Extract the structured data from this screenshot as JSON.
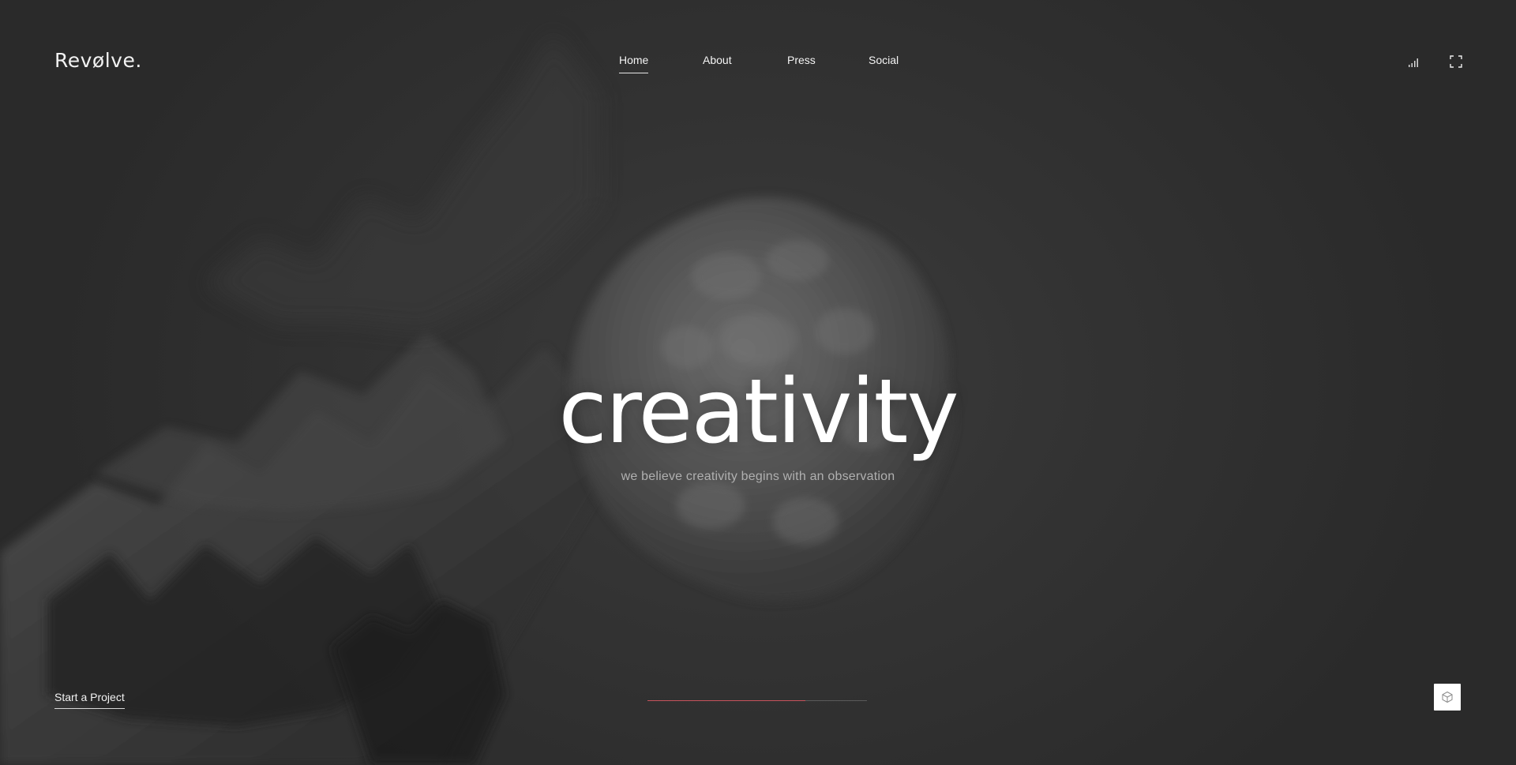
{
  "brand": {
    "logo_text": "Revølve."
  },
  "nav": {
    "items": [
      {
        "label": "Home",
        "active": true
      },
      {
        "label": "About",
        "active": false
      },
      {
        "label": "Press",
        "active": false
      },
      {
        "label": "Social",
        "active": false
      }
    ]
  },
  "header_controls": {
    "sound_icon": "sound-bars-icon",
    "fullscreen_icon": "fullscreen-icon"
  },
  "hero": {
    "title": "creativity",
    "subtitle": "we believe creativity begins with an observation"
  },
  "footer": {
    "cta_label": "Start a Project",
    "progress": 0.72,
    "cube_icon": "cube-icon"
  },
  "colors": {
    "background": "#2e2e2e",
    "text": "#ffffff",
    "subtitle": "#b0b0b0",
    "progress_accent": "#c6535c",
    "progress_track": "#5a5a5a"
  }
}
